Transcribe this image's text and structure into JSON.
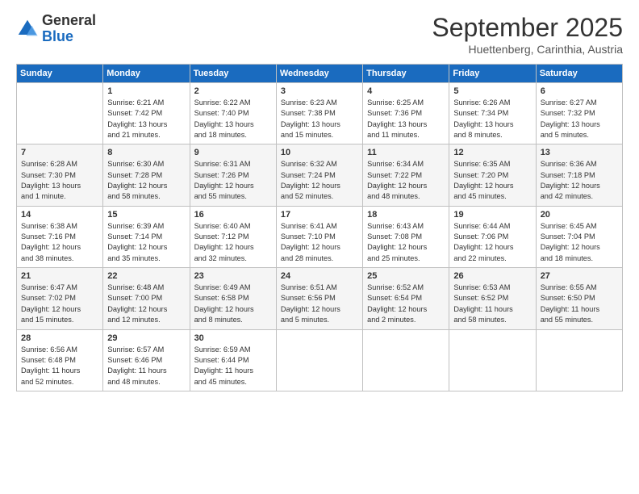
{
  "logo": {
    "general": "General",
    "blue": "Blue"
  },
  "title": "September 2025",
  "subtitle": "Huettenberg, Carinthia, Austria",
  "weekdays": [
    "Sunday",
    "Monday",
    "Tuesday",
    "Wednesday",
    "Thursday",
    "Friday",
    "Saturday"
  ],
  "weeks": [
    [
      {
        "day": "",
        "info": ""
      },
      {
        "day": "1",
        "info": "Sunrise: 6:21 AM\nSunset: 7:42 PM\nDaylight: 13 hours\nand 21 minutes."
      },
      {
        "day": "2",
        "info": "Sunrise: 6:22 AM\nSunset: 7:40 PM\nDaylight: 13 hours\nand 18 minutes."
      },
      {
        "day": "3",
        "info": "Sunrise: 6:23 AM\nSunset: 7:38 PM\nDaylight: 13 hours\nand 15 minutes."
      },
      {
        "day": "4",
        "info": "Sunrise: 6:25 AM\nSunset: 7:36 PM\nDaylight: 13 hours\nand 11 minutes."
      },
      {
        "day": "5",
        "info": "Sunrise: 6:26 AM\nSunset: 7:34 PM\nDaylight: 13 hours\nand 8 minutes."
      },
      {
        "day": "6",
        "info": "Sunrise: 6:27 AM\nSunset: 7:32 PM\nDaylight: 13 hours\nand 5 minutes."
      }
    ],
    [
      {
        "day": "7",
        "info": "Sunrise: 6:28 AM\nSunset: 7:30 PM\nDaylight: 13 hours\nand 1 minute."
      },
      {
        "day": "8",
        "info": "Sunrise: 6:30 AM\nSunset: 7:28 PM\nDaylight: 12 hours\nand 58 minutes."
      },
      {
        "day": "9",
        "info": "Sunrise: 6:31 AM\nSunset: 7:26 PM\nDaylight: 12 hours\nand 55 minutes."
      },
      {
        "day": "10",
        "info": "Sunrise: 6:32 AM\nSunset: 7:24 PM\nDaylight: 12 hours\nand 52 minutes."
      },
      {
        "day": "11",
        "info": "Sunrise: 6:34 AM\nSunset: 7:22 PM\nDaylight: 12 hours\nand 48 minutes."
      },
      {
        "day": "12",
        "info": "Sunrise: 6:35 AM\nSunset: 7:20 PM\nDaylight: 12 hours\nand 45 minutes."
      },
      {
        "day": "13",
        "info": "Sunrise: 6:36 AM\nSunset: 7:18 PM\nDaylight: 12 hours\nand 42 minutes."
      }
    ],
    [
      {
        "day": "14",
        "info": "Sunrise: 6:38 AM\nSunset: 7:16 PM\nDaylight: 12 hours\nand 38 minutes."
      },
      {
        "day": "15",
        "info": "Sunrise: 6:39 AM\nSunset: 7:14 PM\nDaylight: 12 hours\nand 35 minutes."
      },
      {
        "day": "16",
        "info": "Sunrise: 6:40 AM\nSunset: 7:12 PM\nDaylight: 12 hours\nand 32 minutes."
      },
      {
        "day": "17",
        "info": "Sunrise: 6:41 AM\nSunset: 7:10 PM\nDaylight: 12 hours\nand 28 minutes."
      },
      {
        "day": "18",
        "info": "Sunrise: 6:43 AM\nSunset: 7:08 PM\nDaylight: 12 hours\nand 25 minutes."
      },
      {
        "day": "19",
        "info": "Sunrise: 6:44 AM\nSunset: 7:06 PM\nDaylight: 12 hours\nand 22 minutes."
      },
      {
        "day": "20",
        "info": "Sunrise: 6:45 AM\nSunset: 7:04 PM\nDaylight: 12 hours\nand 18 minutes."
      }
    ],
    [
      {
        "day": "21",
        "info": "Sunrise: 6:47 AM\nSunset: 7:02 PM\nDaylight: 12 hours\nand 15 minutes."
      },
      {
        "day": "22",
        "info": "Sunrise: 6:48 AM\nSunset: 7:00 PM\nDaylight: 12 hours\nand 12 minutes."
      },
      {
        "day": "23",
        "info": "Sunrise: 6:49 AM\nSunset: 6:58 PM\nDaylight: 12 hours\nand 8 minutes."
      },
      {
        "day": "24",
        "info": "Sunrise: 6:51 AM\nSunset: 6:56 PM\nDaylight: 12 hours\nand 5 minutes."
      },
      {
        "day": "25",
        "info": "Sunrise: 6:52 AM\nSunset: 6:54 PM\nDaylight: 12 hours\nand 2 minutes."
      },
      {
        "day": "26",
        "info": "Sunrise: 6:53 AM\nSunset: 6:52 PM\nDaylight: 11 hours\nand 58 minutes."
      },
      {
        "day": "27",
        "info": "Sunrise: 6:55 AM\nSunset: 6:50 PM\nDaylight: 11 hours\nand 55 minutes."
      }
    ],
    [
      {
        "day": "28",
        "info": "Sunrise: 6:56 AM\nSunset: 6:48 PM\nDaylight: 11 hours\nand 52 minutes."
      },
      {
        "day": "29",
        "info": "Sunrise: 6:57 AM\nSunset: 6:46 PM\nDaylight: 11 hours\nand 48 minutes."
      },
      {
        "day": "30",
        "info": "Sunrise: 6:59 AM\nSunset: 6:44 PM\nDaylight: 11 hours\nand 45 minutes."
      },
      {
        "day": "",
        "info": ""
      },
      {
        "day": "",
        "info": ""
      },
      {
        "day": "",
        "info": ""
      },
      {
        "day": "",
        "info": ""
      }
    ]
  ]
}
